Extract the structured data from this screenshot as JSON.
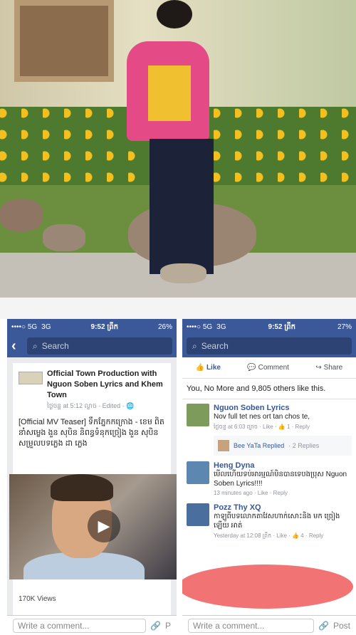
{
  "photo": {
    "alt": "man in pink shirt posing in garden"
  },
  "left_phone": {
    "status": {
      "signal": "••••○ 5G",
      "network": "3G",
      "time": "9:52 ព្រឹក",
      "battery": "26%"
    },
    "search": {
      "placeholder": "Search"
    },
    "post": {
      "title": "Official Town Production with Nguon Soben Lyrics and Khem Town",
      "meta": "ថ្ងៃចន្ទ at 5:12 ល្ងាច · Edited · 🌐",
      "text": "[Official MV Teaser] ទឹកភ្នែកកក្រោង - ខេម ពិតនាំសម្លេង ងួន សុបិន និពន្ធទំនុកច្រៀង ងួន សុបិន សម្រួលបទភ្លេង ដា ភ្លេង",
      "views": "170K Views"
    },
    "composer": {
      "placeholder": "Write a comment...",
      "post": "P"
    }
  },
  "right_phone": {
    "status": {
      "signal": "••••○ 5G",
      "network": "3G",
      "time": "9:52 ព្រឹក",
      "battery": "27%"
    },
    "search": {
      "placeholder": "Search"
    },
    "actions": {
      "like": "Like",
      "comment": "Comment",
      "share": "Share"
    },
    "likes": "You, No More and 9,805 others like this.",
    "comments": [
      {
        "name": "Nguon Soben Lyrics",
        "text": "Nov full tet nes ort tan chos te,",
        "meta": "ថ្ងៃចន្ទ at 6:03 ល្ងាច · Like · 👍 1 · Reply"
      },
      {
        "name": "Heng Dyna",
        "text": "មើលហើយទប់អារម្មណ៍មិនបានទេបងប្រុស Nguon Soben Lyrics!!!!",
        "meta": "13 minutes ago · Like · Reply"
      },
      {
        "name": "Pozz Thy XQ",
        "text": "កាឡូពីបទលោកតាវែសហាក់សោះនិង មក ច្រៀងឡើយ អាត់",
        "meta": "Yesterday at 12:08 ព្រឹក · Like · 👍 4 · Reply"
      }
    ],
    "reply": {
      "name": "Bee YaTa Replied",
      "count": "· 2 Replies"
    },
    "composer": {
      "placeholder": "Write a comment...",
      "post": "Post"
    }
  }
}
